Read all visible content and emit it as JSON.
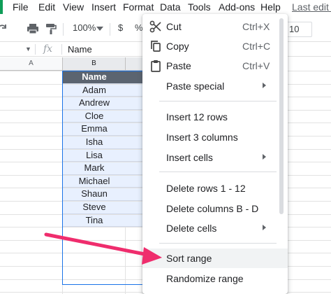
{
  "menubar": {
    "items": [
      "File",
      "Edit",
      "View",
      "Insert",
      "Format",
      "Data",
      "Tools",
      "Add-ons",
      "Help"
    ],
    "last_edit": "Last edit w"
  },
  "toolbar": {
    "zoom": "100%",
    "currency": "$",
    "percent": "%",
    "font_size": "10",
    "icons": [
      "redo-icon",
      "print-icon",
      "paint-format-icon",
      "dropdown-icon"
    ]
  },
  "formula_bar": {
    "fx": "fx",
    "value": "Name"
  },
  "grid": {
    "columns": [
      "A",
      "B"
    ],
    "cells_b": [
      "Name",
      "Adam",
      "Andrew",
      "Cloe",
      "Emma",
      "Isha",
      "Lisa",
      "Mark",
      "Michael",
      "Shaun",
      "Steve",
      "Tina"
    ],
    "header_color": "#5b6470",
    "selection_color": "#e8f0fe",
    "selection_border": "#1a73e8"
  },
  "context_menu": {
    "items": [
      {
        "label": "Cut",
        "shortcut": "Ctrl+X",
        "icon": "scissors-icon"
      },
      {
        "label": "Copy",
        "shortcut": "Ctrl+C",
        "icon": "copy-icon"
      },
      {
        "label": "Paste",
        "shortcut": "Ctrl+V",
        "icon": "clipboard-icon"
      },
      {
        "label": "Paste special",
        "submenu": true
      },
      {
        "label": "Insert 12 rows"
      },
      {
        "label": "Insert 3 columns"
      },
      {
        "label": "Insert cells",
        "submenu": true
      },
      {
        "label": "Delete rows 1 - 12"
      },
      {
        "label": "Delete columns B - D"
      },
      {
        "label": "Delete cells",
        "submenu": true
      },
      {
        "label": "Sort range",
        "highlighted": true
      },
      {
        "label": "Randomize range"
      }
    ]
  },
  "annotation": {
    "arrow_color": "#ef2d6d",
    "points_to": "Sort range"
  }
}
